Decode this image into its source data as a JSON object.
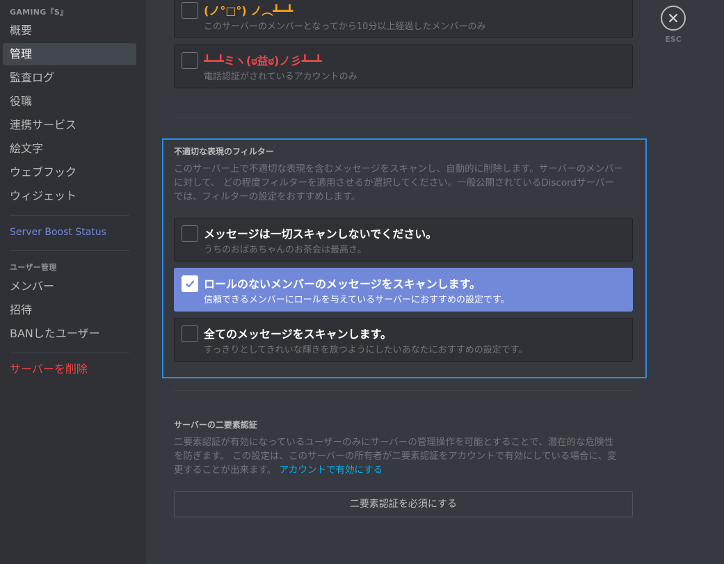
{
  "sidebar": {
    "server_name": "GAMING『S』",
    "items": [
      {
        "label": "概要"
      },
      {
        "label": "管理"
      },
      {
        "label": "監査ログ"
      },
      {
        "label": "役職"
      },
      {
        "label": "連携サービス"
      },
      {
        "label": "絵文字"
      },
      {
        "label": "ウェブフック"
      },
      {
        "label": "ウィジェット"
      }
    ],
    "boost_label": "Server Boost Status",
    "user_mgmt_header": "ユーザー管理",
    "user_items": [
      {
        "label": "メンバー"
      },
      {
        "label": "招待"
      },
      {
        "label": "BANしたユーザー"
      }
    ],
    "delete_label": "サーバーを削除"
  },
  "close": {
    "label": "ESC"
  },
  "verification": {
    "options": [
      {
        "title": "(ノ°□°) ノ︵┻━┻",
        "desc": "このサーバーのメンバーとなってから10分以上経過したメンバーのみ"
      },
      {
        "title": "┻━┻ミヽ(ಠ益ಠ)ノ彡┻━┻",
        "desc": "電話認証がされているアカウントのみ"
      }
    ]
  },
  "filter": {
    "heading": "不適切な表現のフィルター",
    "desc_1": "このサーバー上で不適切な表現を含むメッセージをスキャンし、自動的に削除します。サーバーのメンバー",
    "desc_2": "に対して、 どの程度フィルターを適用させるか選択してください。一般公開されているDiscordサーバー",
    "desc_3": "では、フィルターの設定をおすすめします。",
    "options": [
      {
        "title": "メッセージは一切スキャンしないでください。",
        "desc": "うちのおばあちゃんのお茶会は最高さ。"
      },
      {
        "title": "ロールのないメンバーのメッセージをスキャンします。",
        "desc": "信頼できるメンバーにロールを与えているサーバーにおすすめの設定です。"
      },
      {
        "title": "全てのメッセージをスキャンします。",
        "desc": "すっきりとしてきれいな輝きを放つようにしたいあなたにおすすめの設定です。"
      }
    ]
  },
  "twofa": {
    "heading": "サーバーの二要素認証",
    "desc_1": "二要素認証が有効になっているユーザーのみにサーバーの管理操作を可能とすることで、潜在的な危険性",
    "desc_2": "を防ぎます。 この設定は、このサーバーの所有者が二要素認証をアカウントで有効にしている場合に、変",
    "desc_3": "更することが出来ます。",
    "link": "アカウントで有効にする",
    "button": "二要素認証を必須にする"
  },
  "colors": {
    "accent": "#7289da",
    "danger": "#f04747",
    "highlight": "#2c8ce6",
    "link": "#00b0f4"
  }
}
